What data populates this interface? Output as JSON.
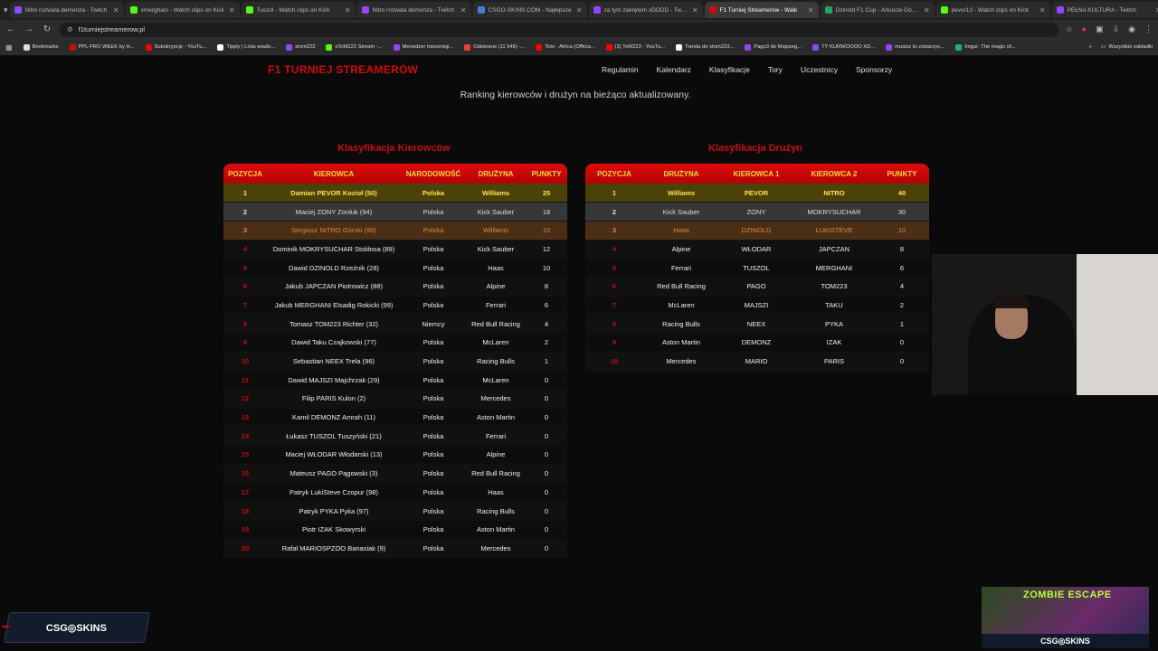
{
  "browser": {
    "tabs": [
      {
        "title": "Nitro rozwala demonza - Twitch",
        "color": "#9146ff"
      },
      {
        "title": "xmerghani - Watch clips on Kick",
        "color": "#53fc18"
      },
      {
        "title": "Tuszol - Watch clips on Kick",
        "color": "#53fc18"
      },
      {
        "title": "Nitro rozwala demonza - Twitch",
        "color": "#9146ff"
      },
      {
        "title": "CSGO-SKINS.COM - Najlepsze",
        "color": "#4a7bd8"
      },
      {
        "title": "za tym zakrętem xDDDD - Twitch",
        "color": "#9146ff"
      },
      {
        "title": "F1 Turniej Streamerów - Walk",
        "color": "#d10a0a",
        "active": true
      },
      {
        "title": "Dzinold F1 Cup - Arkusze Google",
        "color": "#1fa463"
      },
      {
        "title": "pevor13 - Watch clips on Kick",
        "color": "#53fc18"
      },
      {
        "title": "PEŁNA KULTURA - Twitch",
        "color": "#9146ff"
      }
    ],
    "url": "f1turniejstreamerow.pl",
    "bookmarks": [
      {
        "label": "Bookmarks",
        "color": "#ddd"
      },
      {
        "label": "PPL PRO WEEK by H...",
        "color": "#d10a0a"
      },
      {
        "label": "Subskrypcje - YouTu...",
        "color": "#ff0000"
      },
      {
        "label": "Tipply | Lista wiado...",
        "color": "#ffffff"
      },
      {
        "label": "xtom223",
        "color": "#9146ff"
      },
      {
        "label": "xToM223 Stream -...",
        "color": "#53fc18"
      },
      {
        "label": "Menedżer transmisji...",
        "color": "#9146ff"
      },
      {
        "label": "Odebrane (11 548) -...",
        "color": "#ea4335"
      },
      {
        "label": "Toto - Africa (Officia...",
        "color": "#ff0000"
      },
      {
        "label": "(3) ToM223 - YouTu...",
        "color": "#ff0000"
      },
      {
        "label": "Tienda de xtom223...",
        "color": "#ffffff"
      },
      {
        "label": "Pago3 do Majszeg...",
        "color": "#9146ff"
      },
      {
        "label": "TY KURWOOOO XD...",
        "color": "#9146ff"
      },
      {
        "label": "musisz to zobaczyc...",
        "color": "#9146ff"
      },
      {
        "label": "Imgur: The magic of...",
        "color": "#1bb76e"
      }
    ],
    "all_bookmarks": "Wszystkie zakładki"
  },
  "site": {
    "logo": "F1 TURNIEJ STREAMERÓW",
    "menu": [
      "Regulamin",
      "Kalendarz",
      "Klasyfikacje",
      "Tory",
      "Uczestnicy",
      "Sponsorzy"
    ],
    "subtitle": "Ranking kierowców i drużyn na bieżąco aktualizowany.",
    "drivers": {
      "title": "Klasyfikacja Kierowców",
      "headers": [
        "POZYCJA",
        "KIEROWCA",
        "NARODOWOŚĆ",
        "DRUŻYNA",
        "PUNKTY"
      ],
      "rows": [
        [
          "1",
          "Damian PEVOR Kozioł (50)",
          "Polska",
          "Williams",
          "25"
        ],
        [
          "2",
          "Maciej ZONY Zonluk (94)",
          "Polska",
          "Kick Sauber",
          "18"
        ],
        [
          "3",
          "Sergiusz NITRO Górski (95)",
          "Polska",
          "Williams",
          "15"
        ],
        [
          "4",
          "Dominik MOKRYSUCHAR Stokłosa (89)",
          "Polska",
          "Kick Sauber",
          "12"
        ],
        [
          "5",
          "Dawid DZINOLD Rzeźnik (28)",
          "Polska",
          "Haas",
          "10"
        ],
        [
          "6",
          "Jakub JAPCZAN Piotrowicz (88)",
          "Polska",
          "Alpine",
          "8"
        ],
        [
          "7",
          "Jakub MERGHANI Elsadig Rokicki (99)",
          "Polska",
          "Ferrari",
          "6"
        ],
        [
          "8",
          "Tomasz TOM223 Richter (32)",
          "Niemcy",
          "Red Bull Racing",
          "4"
        ],
        [
          "9",
          "Dawid Taku Czajkowski (77)",
          "Polska",
          "McLaren",
          "2"
        ],
        [
          "10",
          "Sebastian NEEX Trela (96)",
          "Polska",
          "Racing Bulls",
          "1"
        ],
        [
          "11",
          "Dawid MAJSZI Majchrzak (29)",
          "Polska",
          "McLaren",
          "0"
        ],
        [
          "12",
          "Filip PARIS Kulon (2)",
          "Polska",
          "Mercedes",
          "0"
        ],
        [
          "13",
          "Kamil DEMONZ Amrah (11)",
          "Polska",
          "Aston Martin",
          "0"
        ],
        [
          "14",
          "Łukasz TUSZOL Tuszyński (21)",
          "Polska",
          "Ferrari",
          "0"
        ],
        [
          "15",
          "Maciej WŁODAR Włodarski (13)",
          "Polska",
          "Alpine",
          "0"
        ],
        [
          "16",
          "Mateusz PAGO Pągowski (3)",
          "Polska",
          "Red Bull Racing",
          "0"
        ],
        [
          "17",
          "Patryk LukiSteve Czopur (98)",
          "Polska",
          "Haas",
          "0"
        ],
        [
          "18",
          "Patryk PYKA Pyka (97)",
          "Polska",
          "Racing Bulls",
          "0"
        ],
        [
          "19",
          "Piotr IZAK Skowyrski",
          "Polska",
          "Aston Martin",
          "0"
        ],
        [
          "20",
          "Rafał MARIOSPZOO Banasiak (9)",
          "Polska",
          "Mercedes",
          "0"
        ]
      ]
    },
    "teams": {
      "title": "Klasyfikacja Drużyn",
      "headers": [
        "POZYCJA",
        "DRUŻYNA",
        "KIEROWCA 1",
        "KIEROWCA 2",
        "PUNKTY"
      ],
      "rows": [
        [
          "1",
          "Williams",
          "PEVOR",
          "NITRO",
          "40"
        ],
        [
          "2",
          "Kick Sauber",
          "ZONY",
          "MOKRYSUCHAR",
          "30"
        ],
        [
          "3",
          "Haas",
          "DZINOLD",
          "LUKISTEVE",
          "10"
        ],
        [
          "4",
          "Alpine",
          "WŁODAR",
          "JAPCZAN",
          "8"
        ],
        [
          "5",
          "Ferrari",
          "TUSZOL",
          "MERGHANI",
          "6"
        ],
        [
          "6",
          "Red Bull Racing",
          "PAGO",
          "TOM223",
          "4"
        ],
        [
          "7",
          "McLaren",
          "MAJSZI",
          "TAKU",
          "2"
        ],
        [
          "8",
          "Racing Bulls",
          "NEEX",
          "PYKA",
          "1"
        ],
        [
          "9",
          "Aston Martin",
          "DEMONZ",
          "IZAK",
          "0"
        ],
        [
          "10",
          "Mercedes",
          "MARIO",
          "PARIS",
          "0"
        ]
      ]
    }
  },
  "overlays": {
    "csg_label": "CSG◎SKINS",
    "zombie_title": "ZOMBIE ESCAPE",
    "zombie_brand": "CSG◎SKINS"
  }
}
